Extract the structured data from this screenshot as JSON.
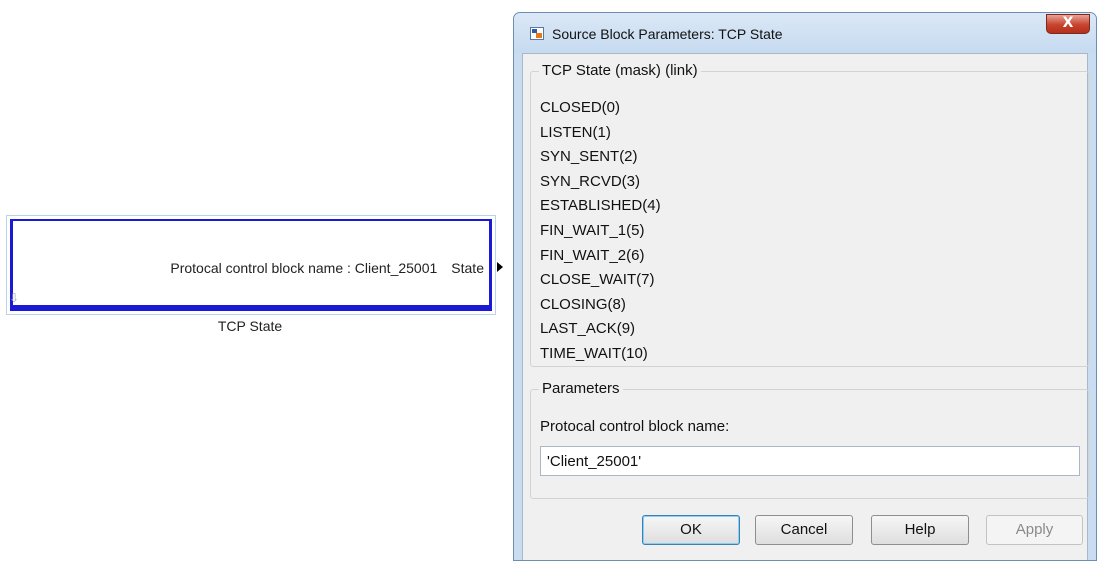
{
  "block": {
    "param_text": "Protocal control block name : Client_25001",
    "port_label": "State",
    "caption": "TCP State"
  },
  "dialog": {
    "title": "Source Block Parameters: TCP State",
    "close_label": "X",
    "description_group": {
      "legend": "TCP State (mask) (link)",
      "states": [
        "CLOSED(0)",
        "LISTEN(1)",
        "SYN_SENT(2)",
        "SYN_RCVD(3)",
        "ESTABLISHED(4)",
        "FIN_WAIT_1(5)",
        "FIN_WAIT_2(6)",
        "CLOSE_WAIT(7)",
        "CLOSING(8)",
        "LAST_ACK(9)",
        "TIME_WAIT(10)"
      ]
    },
    "parameters_group": {
      "legend": "Parameters",
      "field_label": "Protocal control block name:",
      "field_value": "'Client_25001'"
    },
    "buttons": {
      "ok": "OK",
      "cancel": "Cancel",
      "help": "Help",
      "apply": "Apply"
    }
  }
}
